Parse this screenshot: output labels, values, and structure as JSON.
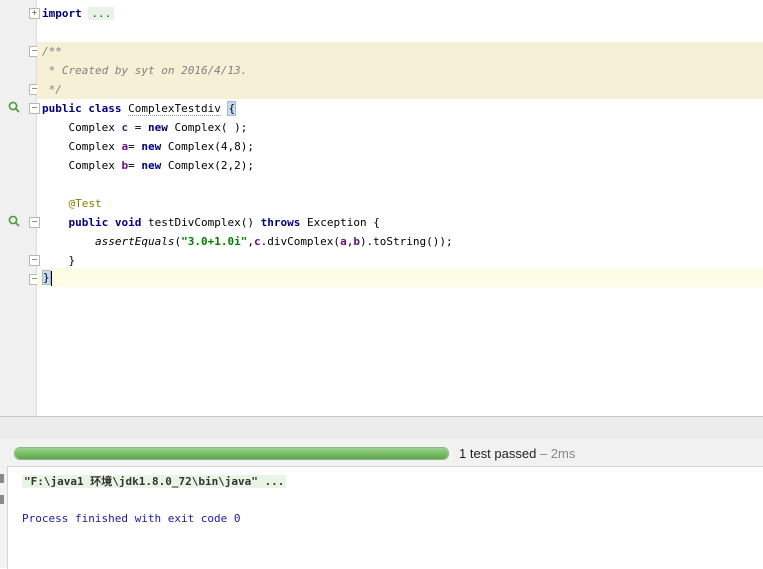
{
  "editor": {
    "import_kw": "import",
    "import_folded": "...",
    "doc_open": "/**",
    "doc_line": " * Created by syt on 2016/4/13.",
    "doc_close": " */",
    "cls_kw1": "public",
    "cls_kw2": "class",
    "cls_name": "ComplexTestdiv",
    "open_brace": "{",
    "f1_type": "Complex",
    "f1_name": "c",
    "f1_eq": " = ",
    "f1_new": "new",
    "f1_ctor": " Complex( );",
    "f2_type": "Complex",
    "f2_name": "a",
    "f2_eq": "= ",
    "f2_new": "new",
    "f2_ctor": " Complex(4,8);",
    "f3_type": "Complex",
    "f3_name": "b",
    "f3_eq": "= ",
    "f3_new": "new",
    "f3_ctor": " Complex(2,2);",
    "annotation": "@Test",
    "m_kw1": "public",
    "m_kw2": "void",
    "m_name": " testDivComplex() ",
    "m_throws": "throws",
    "m_ex": " Exception {",
    "call_fn": "assertEquals",
    "call_p1": "(",
    "call_str": "\"3.0+1.0i\"",
    "call_p2": ",",
    "call_c": "c",
    "call_p3": ".divComplex(",
    "call_a": "a",
    "call_p4": ",",
    "call_b": "b",
    "call_p5": ").toString());",
    "method_close": "}",
    "class_close": "}"
  },
  "run": {
    "progress_percent": 100,
    "status": "1 test passed",
    "duration": " – 2ms",
    "command": "\"F:\\java1 环境\\jdk1.8.0_72\\bin\\java\" ...",
    "exit": "Process finished with exit code 0"
  },
  "colors": {
    "keyword": "#000080",
    "string": "#008000",
    "field": "#660e7a",
    "comment": "#808080",
    "annotation": "#808000",
    "progress": "#5ea849"
  }
}
